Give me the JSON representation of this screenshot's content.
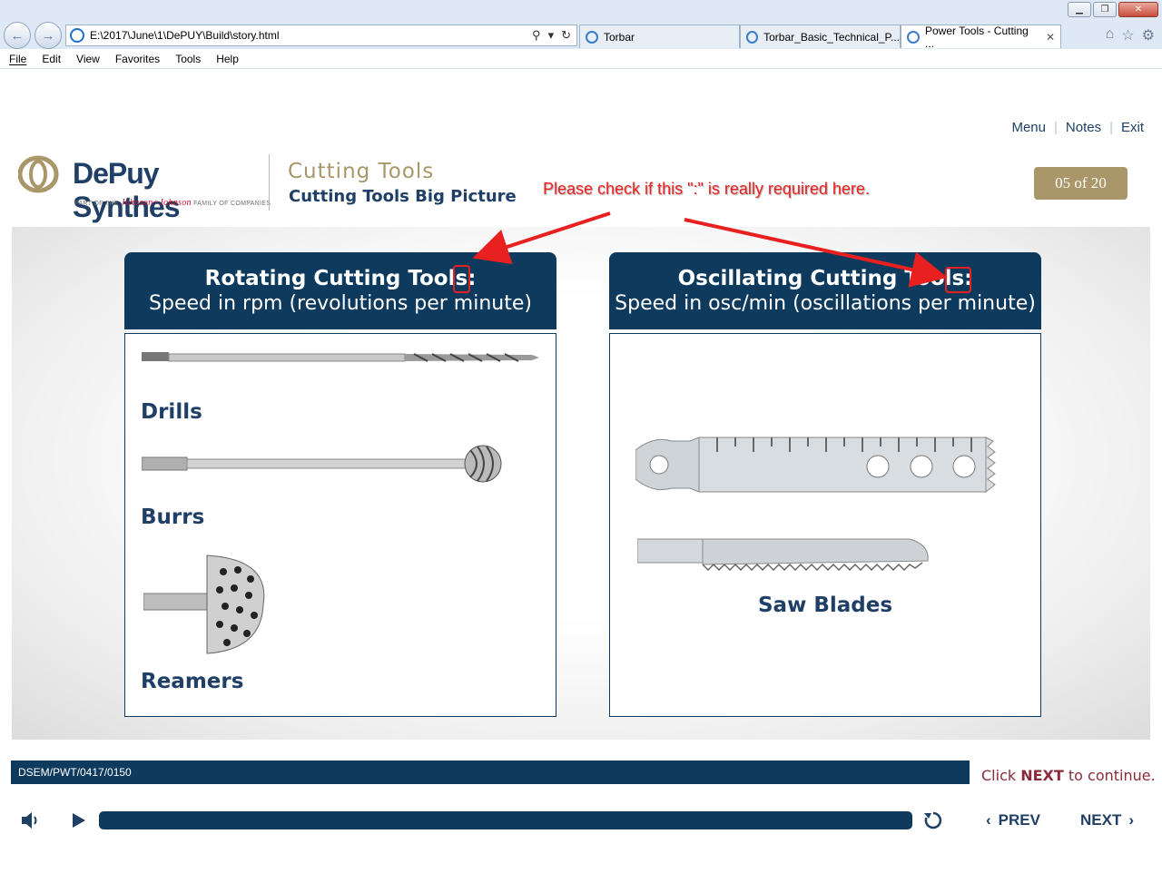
{
  "browser": {
    "address": "E:\\2017\\June\\1\\DePUY\\Build\\story.html",
    "tabs": [
      {
        "label": "Torbar"
      },
      {
        "label": "Torbar_Basic_Technical_P..."
      },
      {
        "label": "Power Tools - Cutting ..."
      }
    ],
    "menu": [
      "File",
      "Edit",
      "View",
      "Favorites",
      "Tools",
      "Help"
    ]
  },
  "player": {
    "links": [
      "Menu",
      "Notes",
      "Exit"
    ],
    "logo_name": "DePuy Synthes",
    "logo_tagline_pre": "PART OF THE",
    "logo_tagline_brand": "Johnson+Johnson",
    "logo_tagline_post": "FAMILY OF COMPANIES",
    "course_title": "Cutting Tools",
    "slide_title": "Cutting Tools Big Picture",
    "counter": "05 of 20"
  },
  "annotation": {
    "text": "Please check if this \":\" is really required here."
  },
  "rotating": {
    "title": "Rotating Cutting Tools:",
    "subtitle": "Speed in rpm (revolutions per minute)",
    "items": [
      "Drills",
      "Burrs",
      "Reamers"
    ]
  },
  "oscillating": {
    "title": "Oscillating Cutting Tools:",
    "subtitle": "Speed in osc/min (oscillations per minute)",
    "items": [
      "Saw Blades"
    ]
  },
  "footer": {
    "code": "DSEM/PWT/0417/0150",
    "hint_pre": "Click",
    "hint_key": "NEXT",
    "hint_post": "to continue.",
    "prev": "PREV",
    "next": "NEXT"
  },
  "icons": [
    "back-icon",
    "forward-icon",
    "ie-icon",
    "search-icon",
    "refresh-icon",
    "home-icon",
    "star-icon",
    "gear-icon",
    "volume-icon",
    "play-icon",
    "replay-icon",
    "chevron-left-icon",
    "chevron-right-icon"
  ],
  "colors": {
    "navy": "#0e3a5e",
    "gold": "#a9976a",
    "annotation_red": "#f02020",
    "hint_red": "#8a2a3a"
  }
}
